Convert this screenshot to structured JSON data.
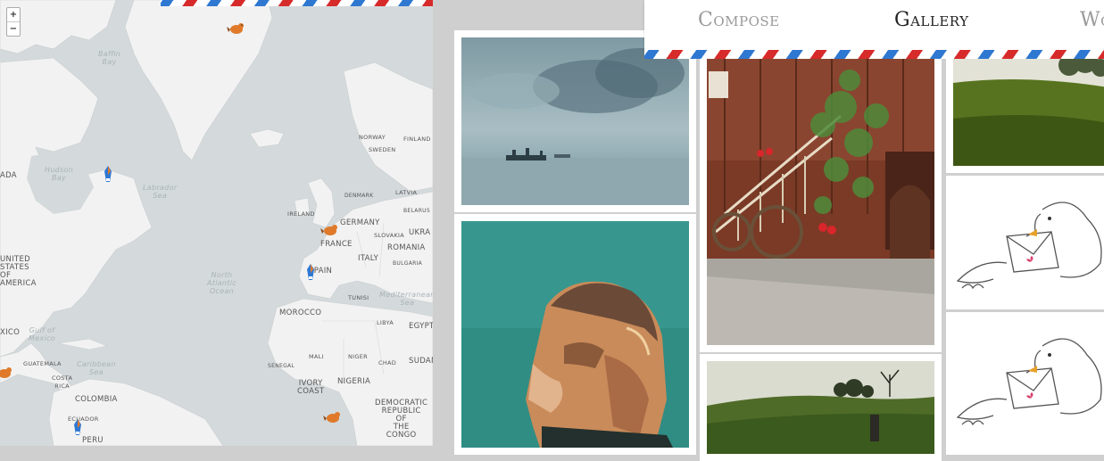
{
  "nav": {
    "tabs": [
      {
        "label": "Compose",
        "active": false
      },
      {
        "label": "Gallery",
        "active": true
      },
      {
        "label": "Wo",
        "active": false
      }
    ]
  },
  "map": {
    "zoom_in": "+",
    "zoom_out": "−",
    "labels": {
      "baffin_bay": "Baffin\nBay",
      "hudson_bay": "Hudson\nBay",
      "labrador_sea": "Labrador\nSea",
      "north_atlantic": "North\nAtlantic\nOcean",
      "gulf_mexico": "Gulf of\nMexico",
      "caribbean": "Caribbean\nSea",
      "mediterranean": "Mediterranean\nSea",
      "ada": "ADA",
      "united_states": "UNITED\nSTATES\nOF\nAMERICA",
      "mexico": "XICO",
      "guatemala": "GUATEMALA",
      "costa": "COSTA\nRICA",
      "colombia": "COLOMBIA",
      "ecuador": "ECUADOR",
      "peru": "PERU",
      "norway": "NORWAY",
      "sweden": "SWEDEN",
      "finland": "FINLAND",
      "denmark": "DENMARK",
      "latvia": "LATVIA",
      "belarus": "BELARUS",
      "ireland": "IRELAND",
      "germany": "GERMANY",
      "france": "FRANCE",
      "slovakia": "SLOVAKIA",
      "ukraine": "UKRA",
      "romania": "ROMANIA",
      "bulgaria": "BULGARIA",
      "italy": "ITALY",
      "spain": "SPAIN",
      "tunisia": "TUNISI",
      "morocco": "MOROCCO",
      "libya": "LIBYA",
      "egypt": "EGYPT",
      "mali": "MALI",
      "niger": "NIGER",
      "chad": "CHAD",
      "sudan": "SUDAN",
      "senegal": "SENEGAL",
      "ivory_coast": "IVORY\nCOAST",
      "nigeria": "NIGERIA",
      "drc": "DEMOCRATIC\nREPUBLIC\nOF\nTHE\nCONGO"
    }
  },
  "gallery": {
    "tiles": [
      {
        "id": "seascape",
        "subject": "misty sea painting"
      },
      {
        "id": "portrait",
        "subject": "pastel portrait"
      },
      {
        "id": "staircase",
        "subject": "wooden house with staircase and cart"
      },
      {
        "id": "field",
        "subject": "green field with trees"
      },
      {
        "id": "field2",
        "subject": "green field at sunrise"
      },
      {
        "id": "bird1",
        "subject": "bird carrying letter sketch"
      },
      {
        "id": "bird2",
        "subject": "bird carrying letter sketch"
      }
    ]
  },
  "colors": {
    "airmail_red": "#d72b2b",
    "airmail_blue": "#2f78d2",
    "pin_orange": "#e07a2a"
  }
}
